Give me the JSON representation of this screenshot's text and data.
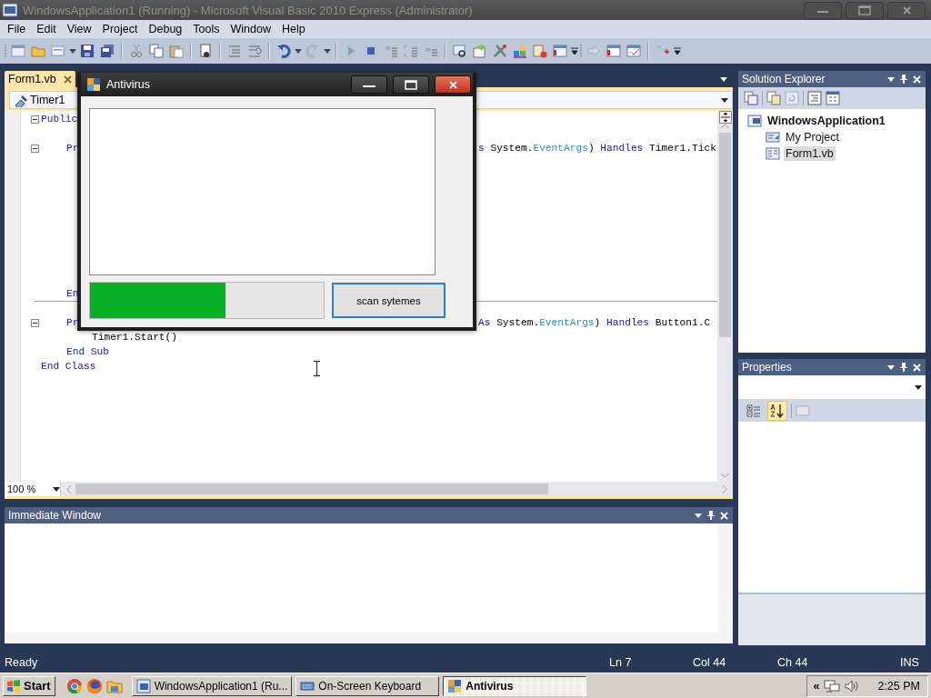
{
  "window": {
    "title": "WindowsApplication1 (Running) - Microsoft Visual Basic 2010 Express (Administrator)"
  },
  "menu": [
    "File",
    "Edit",
    "View",
    "Project",
    "Debug",
    "Tools",
    "Window",
    "Help"
  ],
  "document_tabs": [
    {
      "label": "Form1.vb",
      "selected": true
    }
  ],
  "navigation": {
    "object": "Timer1"
  },
  "code": [
    {
      "kind": "code",
      "tokens": [
        {
          "kind": "keyword",
          "text": "Public"
        }
      ],
      "children": [
        {
          "kind": "blank"
        },
        {
          "kind": "code",
          "tokens": [
            {
              "kind": "keyword",
              "text": "Pr"
            }
          ],
          "tail": [
            {
              "kind": "keyword",
              "text": "s"
            },
            {
              "kind": "plain",
              "text": " System."
            },
            {
              "kind": "type",
              "text": "EventArgs"
            },
            {
              "kind": "plain",
              "text": ") "
            },
            {
              "kind": "keyword",
              "text": "Handles"
            },
            {
              "kind": "plain",
              "text": " Timer1.Tick"
            }
          ],
          "children": [
            {
              "kind": "blank"
            },
            {
              "kind": "blank"
            },
            {
              "kind": "blank"
            },
            {
              "kind": "blank"
            },
            {
              "kind": "blank"
            },
            {
              "kind": "blank"
            },
            {
              "kind": "blank"
            },
            {
              "kind": "blank"
            },
            {
              "kind": "blank"
            }
          ]
        },
        {
          "kind": "code",
          "tokens": [
            {
              "kind": "keyword",
              "text": "En"
            }
          ]
        },
        {
          "kind": "divider"
        },
        {
          "kind": "code",
          "tokens": [
            {
              "kind": "keyword",
              "text": "Pr"
            }
          ],
          "tail": [
            {
              "kind": "keyword",
              "text": "As"
            },
            {
              "kind": "plain",
              "text": " System."
            },
            {
              "kind": "type",
              "text": "EventArgs"
            },
            {
              "kind": "plain",
              "text": ") "
            },
            {
              "kind": "keyword",
              "text": "Handles"
            },
            {
              "kind": "plain",
              "text": " Button1.C"
            }
          ],
          "children": [
            {
              "kind": "code",
              "tokens": [
                {
                  "kind": "plain",
                  "text": "Timer1.Start()"
                }
              ]
            }
          ]
        },
        {
          "kind": "code",
          "tokens": [
            {
              "kind": "keyword",
              "text": "End Sub"
            }
          ]
        }
      ]
    },
    {
      "kind": "code",
      "tokens": [
        {
          "kind": "keyword",
          "text": "End Class"
        }
      ]
    }
  ],
  "zoom": "100 %",
  "solution_explorer": {
    "title": "Solution Explorer",
    "tree": [
      {
        "label": "WindowsApplication1",
        "selected": false,
        "children": [
          {
            "label": "My Project",
            "selected": false
          },
          {
            "label": "Form1.vb",
            "selected": true
          }
        ]
      }
    ]
  },
  "properties": {
    "title": "Properties",
    "sort_modes": [
      {
        "kind": "categorized",
        "selected": false
      },
      {
        "kind": "alphabetical",
        "selected": true
      }
    ]
  },
  "immediate_window": {
    "title": "Immediate Window"
  },
  "status_bar": {
    "message": "Ready",
    "line": "Ln 7",
    "column": "Col 44",
    "character": "Ch 44",
    "mode": "INS"
  },
  "app_window": {
    "title": "Antivirus",
    "progress": {
      "level": 0.58
    },
    "scan_button": "scan sytemes"
  },
  "taskbar": {
    "start": "Start",
    "tasks": [
      {
        "label": "WindowsApplication1 (Ru...",
        "selected": false
      },
      {
        "label": "On-Screen Keyboard",
        "selected": false
      },
      {
        "label": "Antivirus",
        "selected": true
      }
    ],
    "tray_expand": "«",
    "clock": "2:25 PM"
  }
}
